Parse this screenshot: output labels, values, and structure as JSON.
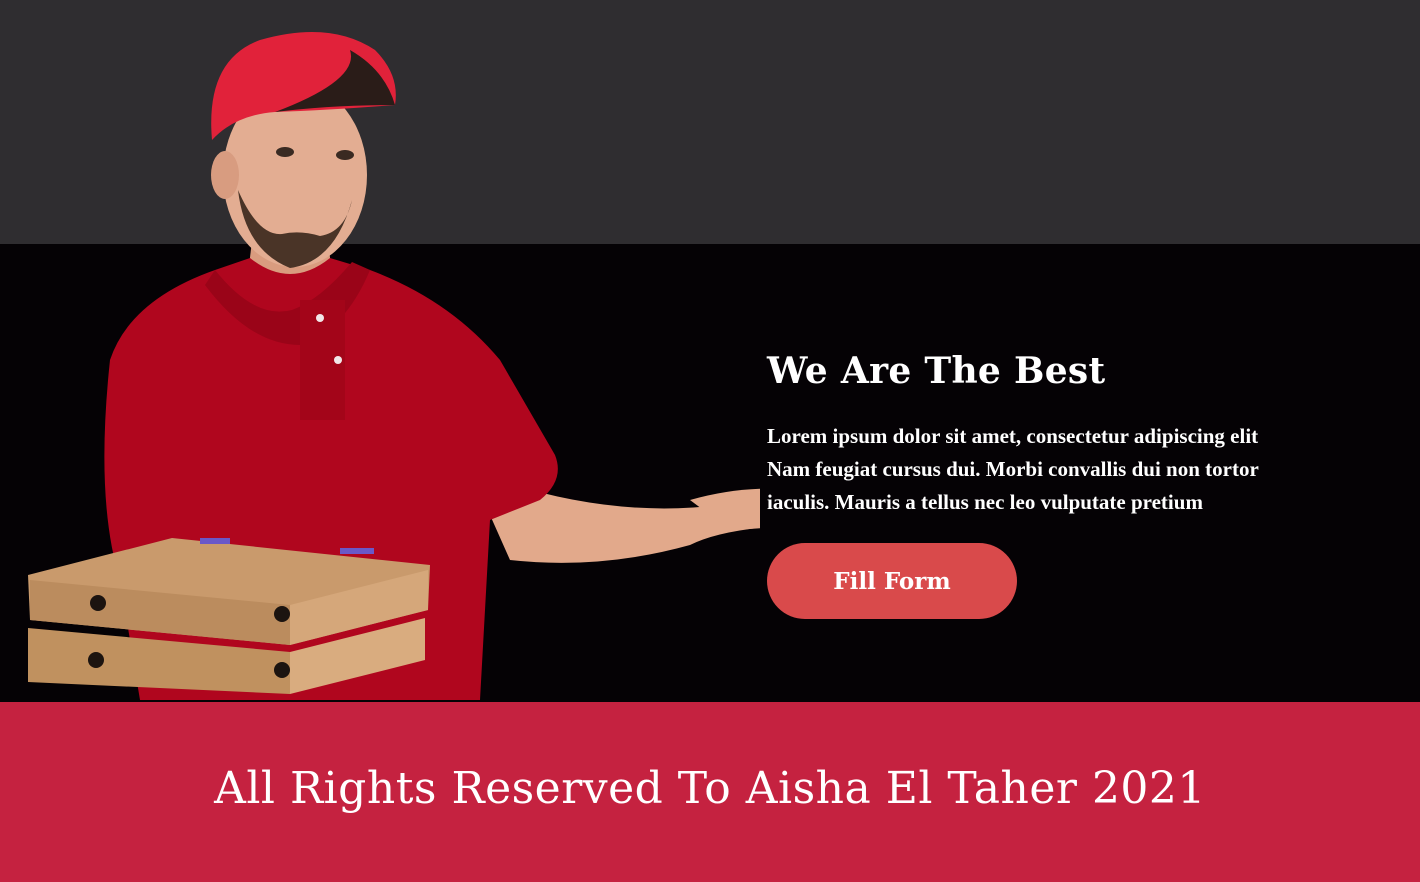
{
  "hero": {
    "title": "We Are The Best",
    "text": "Lorem ipsum dolor sit amet, consectetur adipiscing elit\n Nam feugiat cursus dui. Morbi convallis dui non tortor\niaculis. Mauris  a tellus nec leo vulputate pretium",
    "button_label": "Fill Form",
    "image": "delivery-man-holding-pizza-boxes"
  },
  "footer": {
    "text": "All Rights Reserved To Aisha El Taher 2021"
  },
  "colors": {
    "top_band": "#2f2d30",
    "hero_band": "#050205",
    "footer": "#c52240",
    "button": "#d94a4b",
    "text": "#ffffff"
  }
}
